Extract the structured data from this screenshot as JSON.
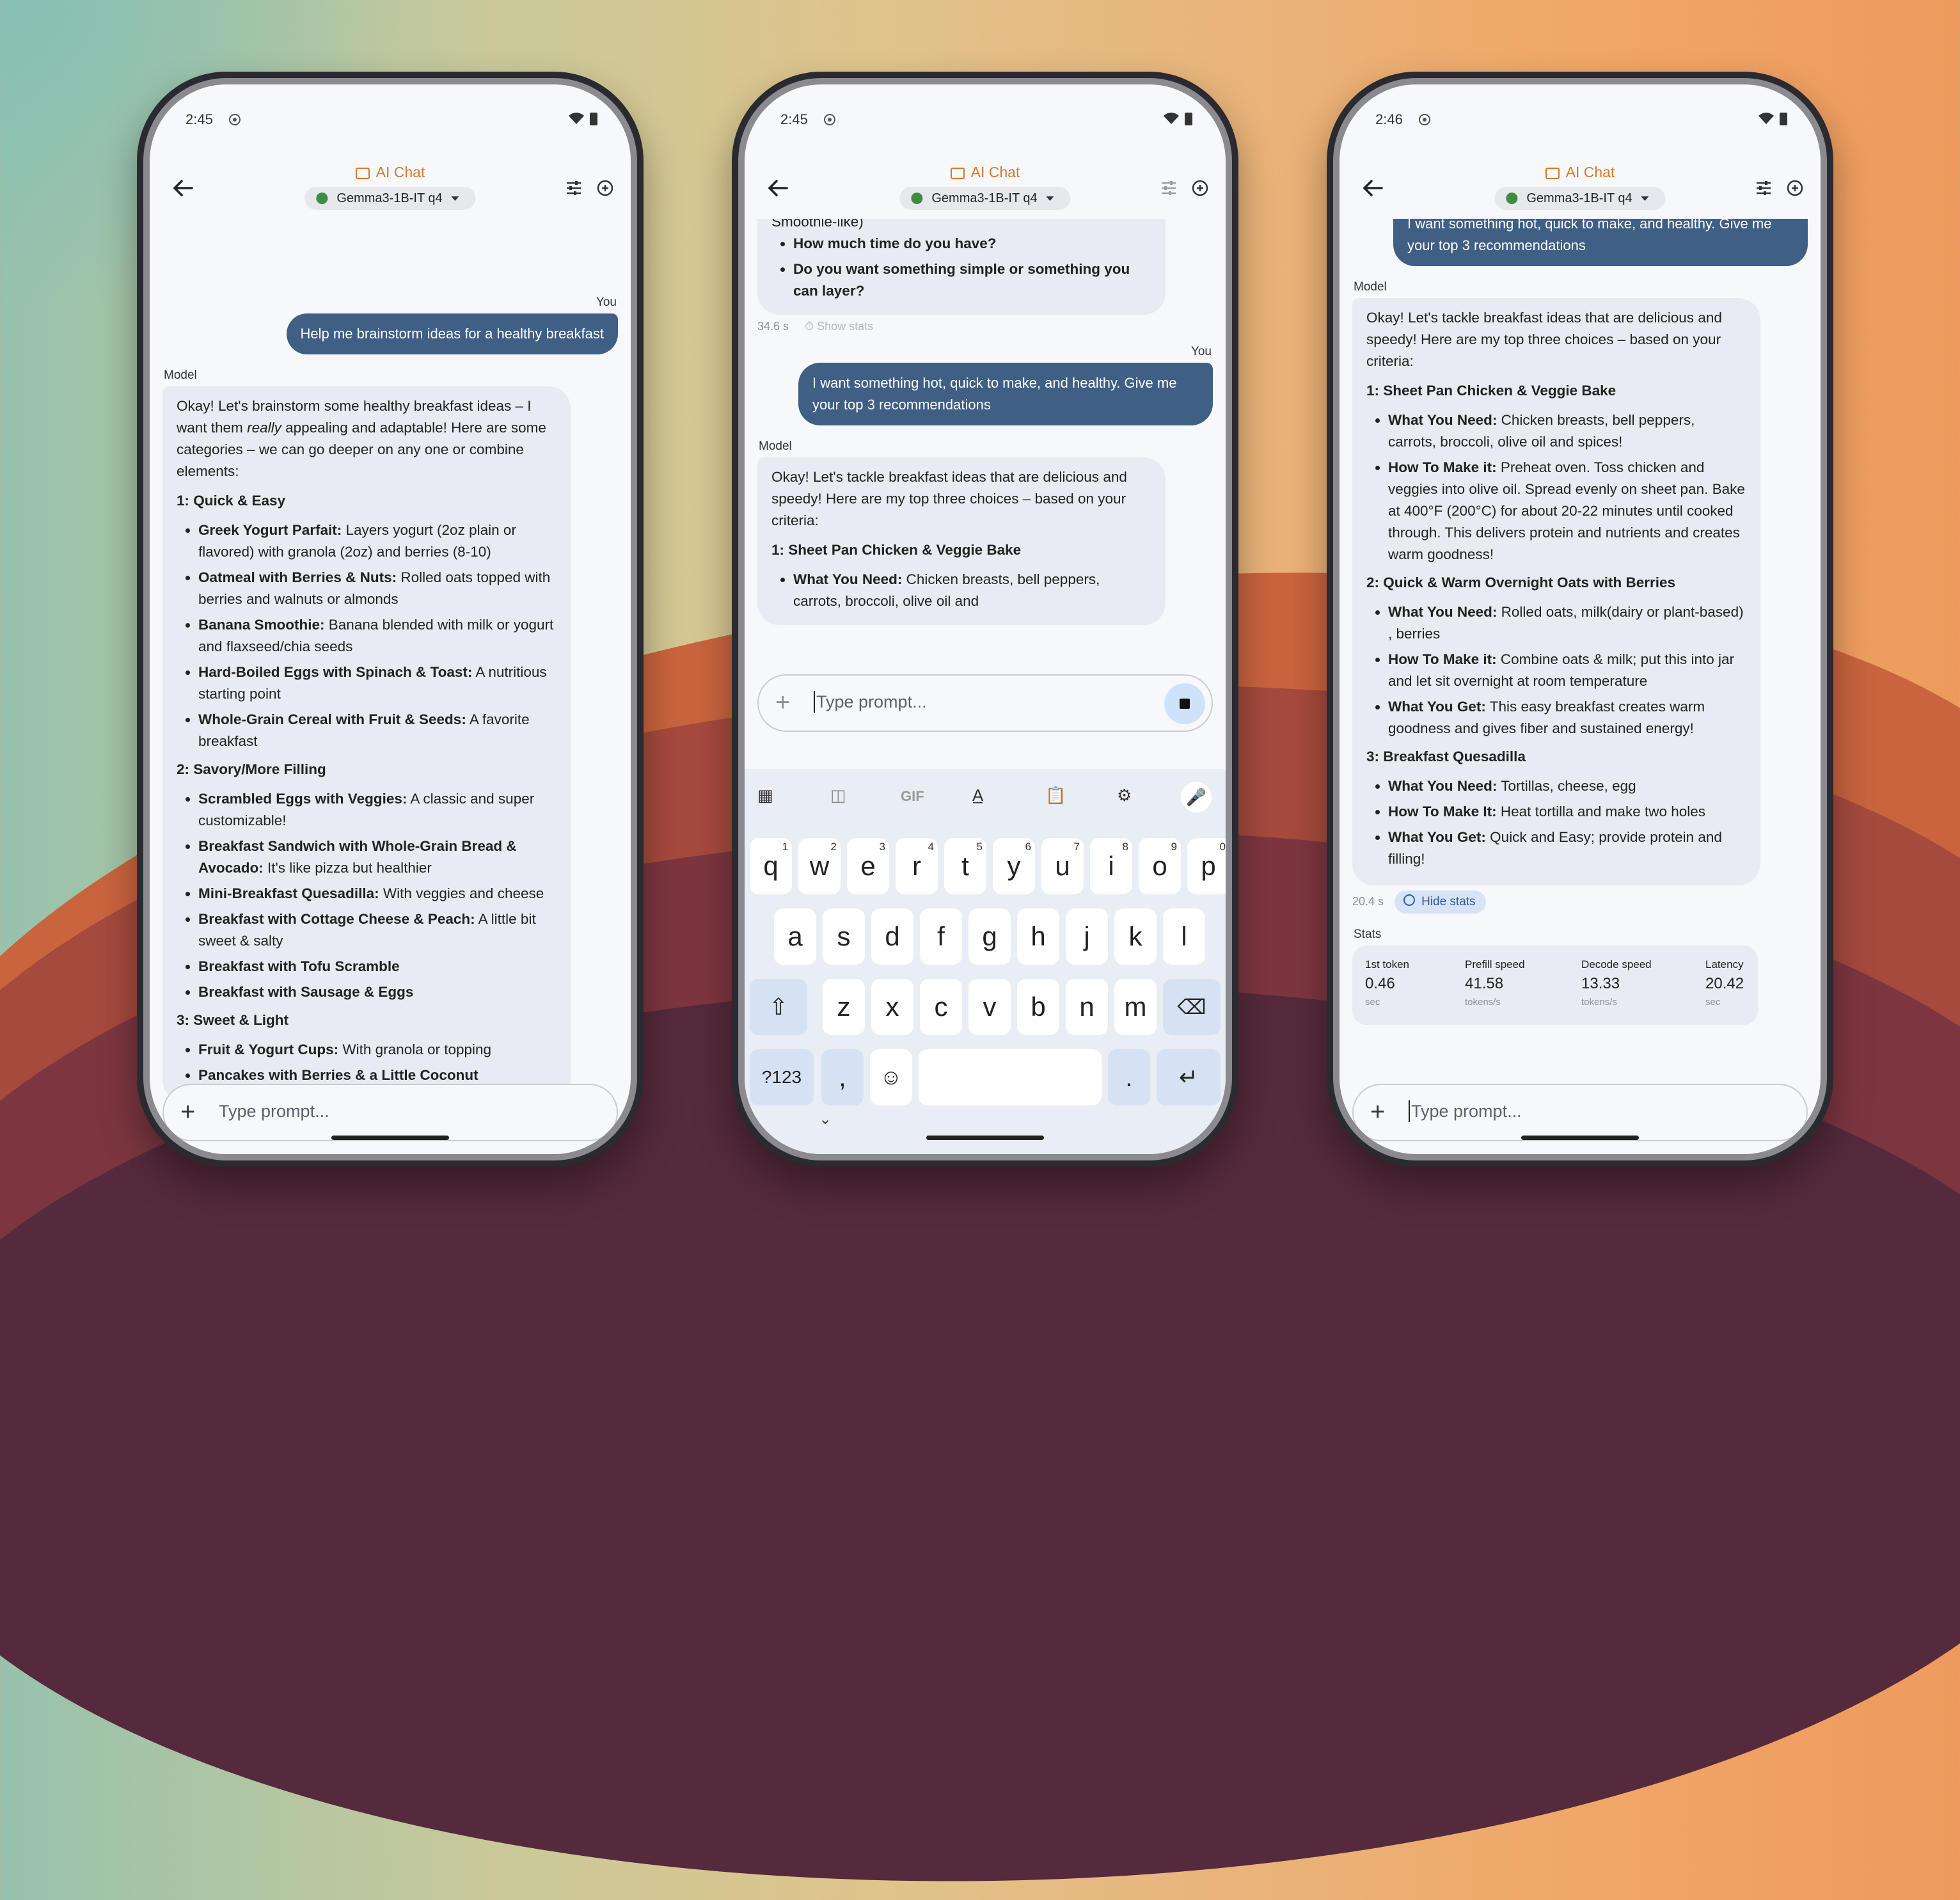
{
  "screens": [
    {
      "status_time": "2:45",
      "app_title": "AI Chat",
      "model": "Gemma3-1B-IT q4",
      "you_label": "You",
      "user_message": "Help me brainstorm ideas for a healthy breakfast",
      "model_label": "Model",
      "intro_a": "Okay! Let's brainstorm some healthy breakfast ideas – I want them",
      "intro_em": "really",
      "intro_b": "appealing and adaptable! Here are some categories – we can go deeper on any one or combine elements:",
      "sections": [
        {
          "title": "1:  Quick & Easy",
          "items": [
            {
              "b": "Greek Yogurt Parfait:",
              "t": " Layers yogurt (2oz plain or flavored) with granola (2oz) and berries (8-10)"
            },
            {
              "b": "Oatmeal with Berries & Nuts:",
              "t": " Rolled oats topped with berries and walnuts or almonds"
            },
            {
              "b": "Banana Smoothie:",
              "t": " Banana blended with milk or yogurt and flaxseed/chia seeds"
            },
            {
              "b": "Hard-Boiled Eggs with Spinach & Toast:",
              "t": " A nutritious starting point"
            },
            {
              "b": "Whole-Grain Cereal with Fruit & Seeds:",
              "t": " A favorite breakfast"
            }
          ]
        },
        {
          "title": "2:  Savory/More Filling",
          "items": [
            {
              "b": "Scrambled Eggs with Veggies:",
              "t": " A classic and super customizable!"
            },
            {
              "b": "Breakfast Sandwich with Whole-Grain Bread & Avocado:",
              "t": " It's like pizza but healthier"
            },
            {
              "b": "Mini-Breakfast Quesadilla:",
              "t": " With veggies and cheese"
            },
            {
              "b": "Breakfast with Cottage Cheese & Peach:",
              "t": " A little bit sweet & salty"
            },
            {
              "b": "Breakfast with Tofu Scramble",
              "t": ""
            },
            {
              "b": "Breakfast with Sausage & Eggs",
              "t": ""
            }
          ]
        },
        {
          "title": "3:  Sweet & Light",
          "items": [
            {
              "b": "Fruit & Yogurt Cups:",
              "t": " With granola or topping"
            },
            {
              "b": "Pancakes with Berries & a Little Coconut",
              "t": ""
            }
          ]
        }
      ],
      "input_placeholder": "Type prompt..."
    },
    {
      "status_time": "2:45",
      "app_title": "AI Chat",
      "model": "Gemma3-1B-IT q4",
      "prev_cut": "Smoothie-like)",
      "prev_items": [
        "How much time do you have?",
        "Do you want something simple or something you can layer?"
      ],
      "prev_time": "34.6 s",
      "show_stats": "Show stats",
      "you_label": "You",
      "user_message": "I want something hot, quick to make, and healthy. Give me your top 3 recommendations",
      "model_label": "Model",
      "reply_intro": "Okay! Let's tackle breakfast ideas that are delicious and speedy! Here are my top three choices – based on your criteria:",
      "reply_title": "1:  Sheet Pan Chicken & Veggie Bake",
      "reply_item_b": "What You Need:",
      "reply_item_t": " Chicken breasts, bell peppers, carrots, broccoli, olive oil and",
      "input_placeholder": "Type prompt...",
      "keyboard": {
        "row1": [
          "q",
          "w",
          "e",
          "r",
          "t",
          "y",
          "u",
          "i",
          "o",
          "p"
        ],
        "row1_nums": [
          "1",
          "2",
          "3",
          "4",
          "5",
          "6",
          "7",
          "8",
          "9",
          "0"
        ],
        "row2": [
          "a",
          "s",
          "d",
          "f",
          "g",
          "h",
          "j",
          "k",
          "l"
        ],
        "row3": [
          "z",
          "x",
          "c",
          "v",
          "b",
          "n",
          "m"
        ],
        "sym": "?123",
        "comma": ",",
        "period": ".",
        "gif": "GIF"
      }
    },
    {
      "status_time": "2:46",
      "app_title": "AI Chat",
      "model": "Gemma3-1B-IT q4",
      "user_message": "I want something hot, quick to make, and healthy. Give me your top 3 recommendations",
      "model_label": "Model",
      "reply_intro": "Okay! Let's tackle breakfast ideas that are delicious and speedy! Here are my top three choices – based on your criteria:",
      "sections": [
        {
          "title": "1:  Sheet Pan Chicken & Veggie Bake",
          "items": [
            {
              "b": "What You Need:",
              "t": " Chicken breasts, bell peppers, carrots, broccoli, olive oil and spices!"
            },
            {
              "b": "How To Make it:",
              "t": " Preheat oven.  Toss chicken and veggies into olive oil. Spread evenly on sheet pan. Bake at 400°F (200°C) for about 20-22 minutes until cooked through. This delivers protein and nutrients and creates warm goodness!"
            }
          ]
        },
        {
          "title": "2:  Quick & Warm Overnight Oats with Berries",
          "items": [
            {
              "b": "What You Need:",
              "t": " Rolled oats, milk(dairy or plant-based) , berries"
            },
            {
              "b": "How To Make it:",
              "t": " Combine oats & milk; put this into jar and let sit overnight at room temperature"
            },
            {
              "b": "What You Get:",
              "t": " This easy breakfast creates warm goodness and gives fiber and sustained energy!"
            }
          ]
        },
        {
          "title": "3:  Breakfast Quesadilla",
          "items": [
            {
              "b": "What You Need:",
              "t": " Tortillas, cheese, egg"
            },
            {
              "b": "How To Make It:",
              "t": " Heat tortilla and make two holes"
            },
            {
              "b": "What You Get:",
              "t": " Quick and Easy; provide protein and filling!"
            }
          ]
        }
      ],
      "reply_time": "20.4 s",
      "hide_stats": "Hide stats",
      "stats_label": "Stats",
      "stats": [
        {
          "title": "1st token",
          "value": "0.46",
          "unit": "sec"
        },
        {
          "title": "Prefill speed",
          "value": "41.58",
          "unit": "tokens/s"
        },
        {
          "title": "Decode speed",
          "value": "13.33",
          "unit": "tokens/s"
        },
        {
          "title": "Latency",
          "value": "20.42",
          "unit": "sec"
        }
      ],
      "input_placeholder": "Type prompt..."
    }
  ],
  "colors": {
    "accent": "#d9772b",
    "user_bubble": "#3f5f85",
    "model_bubble": "#e8ebf2",
    "model_dot": "#3d8c3f"
  }
}
